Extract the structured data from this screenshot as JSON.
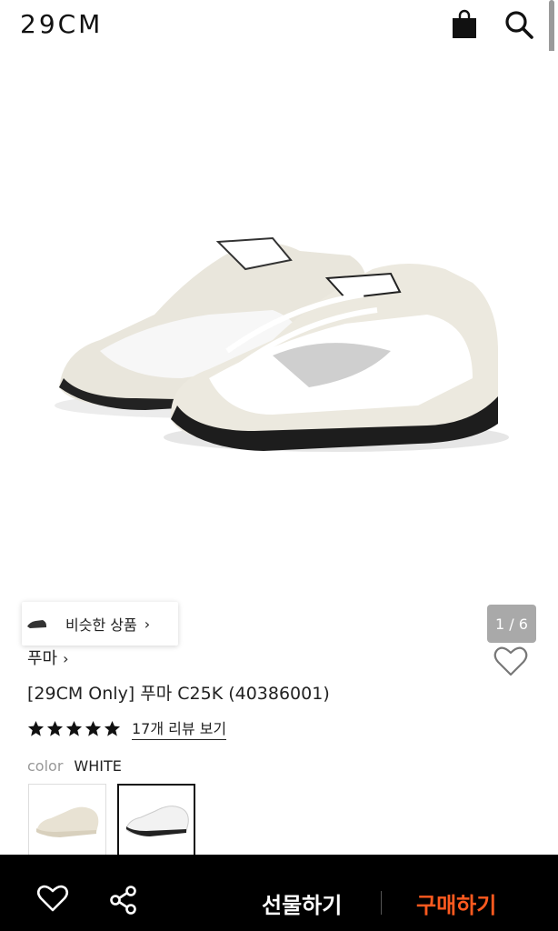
{
  "header": {
    "logo": "29CM",
    "bag_icon": "shopping-bag-icon",
    "search_icon": "search-icon"
  },
  "hero": {
    "similar_products_label": "비슷한 상품",
    "similar_products_chevron": "›",
    "page_indicator": "1 / 6"
  },
  "product": {
    "brand": "푸마",
    "brand_chevron": "›",
    "title": "[29CM Only] 푸마 C25K (40386001)",
    "rating_stars": 5,
    "review_link": "17개 리뷰 보기",
    "color_key": "color",
    "color_value": "WHITE",
    "swatches": [
      {
        "name": "cream",
        "selected": false
      },
      {
        "name": "white",
        "selected": true
      }
    ]
  },
  "bottom_bar": {
    "heart_icon": "heart-outline-icon",
    "share_icon": "share-icon",
    "gift_label": "선물하기",
    "buy_label": "구매하기",
    "buy_color": "#ff5a1f"
  }
}
